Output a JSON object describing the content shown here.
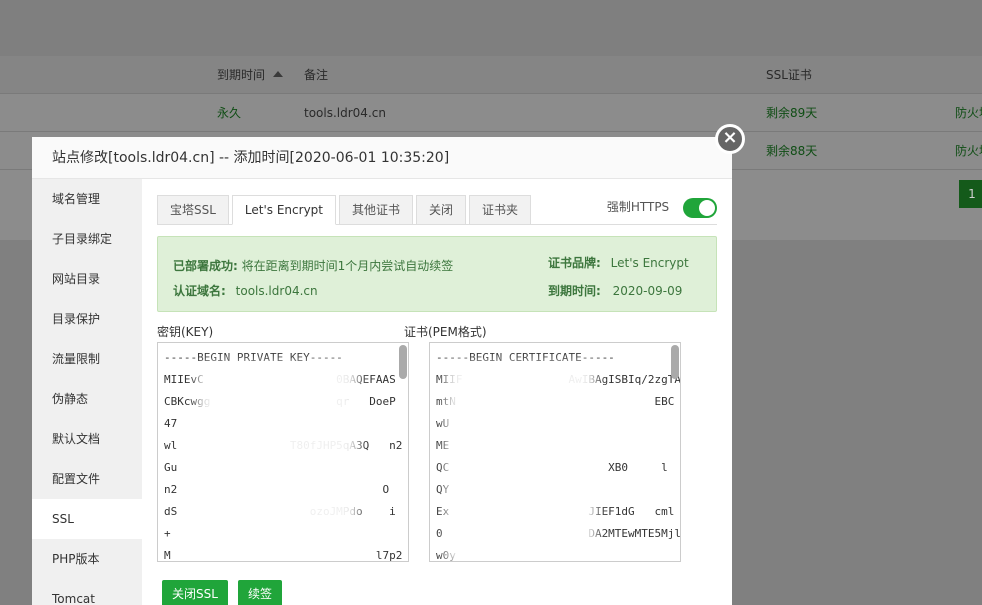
{
  "background": {
    "header": {
      "expire": "到期时间",
      "remark": "备注",
      "ssl": "SSL证书"
    },
    "rows": [
      {
        "expire": "永久",
        "remark": "tools.ldr04.cn",
        "ssl": "剩余89天",
        "extra": "防火墙"
      },
      {
        "expire": "",
        "remark": "",
        "ssl": "剩余88天",
        "extra": "防火墙"
      }
    ],
    "page": "1"
  },
  "modal": {
    "title": "站点修改[tools.ldr04.cn] -- 添加时间[2020-06-01 10:35:20]",
    "close": "×",
    "sidebar": [
      "域名管理",
      "子目录绑定",
      "网站目录",
      "目录保护",
      "流量限制",
      "伪静态",
      "默认文档",
      "配置文件",
      "SSL",
      "PHP版本",
      "Tomcat"
    ],
    "tabs": [
      "宝塔SSL",
      "Let's Encrypt",
      "其他证书",
      "关闭",
      "证书夹"
    ],
    "active_tab": 1,
    "force_https_label": "强制HTTPS",
    "force_https": true,
    "info": {
      "deployed_label": "已部署成功:",
      "deployed_text": "将在距离到期时间1个月内尝试自动续签",
      "domain_label": "认证域名:",
      "domain_value": "tools.ldr04.cn",
      "brand_label": "证书品牌:",
      "brand_value": "Let's Encrypt",
      "expire_label": "到期时间:",
      "expire_value": "2020-09-09"
    },
    "key_label": "密钥(KEY)",
    "cert_label": "证书(PEM格式)",
    "key_text": "-----BEGIN PRIVATE KEY-----\nMIIEvC                    0BAQEFAAS\nCBKcwgg                   qr   DoeP\n47\nwl                 T80fJHP5qA3Q   n2\nGu                               \nn2                               O\ndS                    ozoJMPdo    i\n+\nM                               l7p2",
    "cert_text": "-----BEGIN CERTIFICATE-----\nMIIF                AwIBAgISBIq/2zgTAaW\nmtN                              EBC\nwU\nME                                \nQC                        XB0     l\nQY\nEx                     JIEF1dG   cml\n0                      DA2MTEwMTE5MjlaF\nw0y",
    "buttons": {
      "close_ssl": "关闭SSL",
      "renew": "续签"
    },
    "colors": {
      "accent": "#20a53a",
      "info_bg": "#dff0d8",
      "info_text": "#3c763d"
    }
  }
}
